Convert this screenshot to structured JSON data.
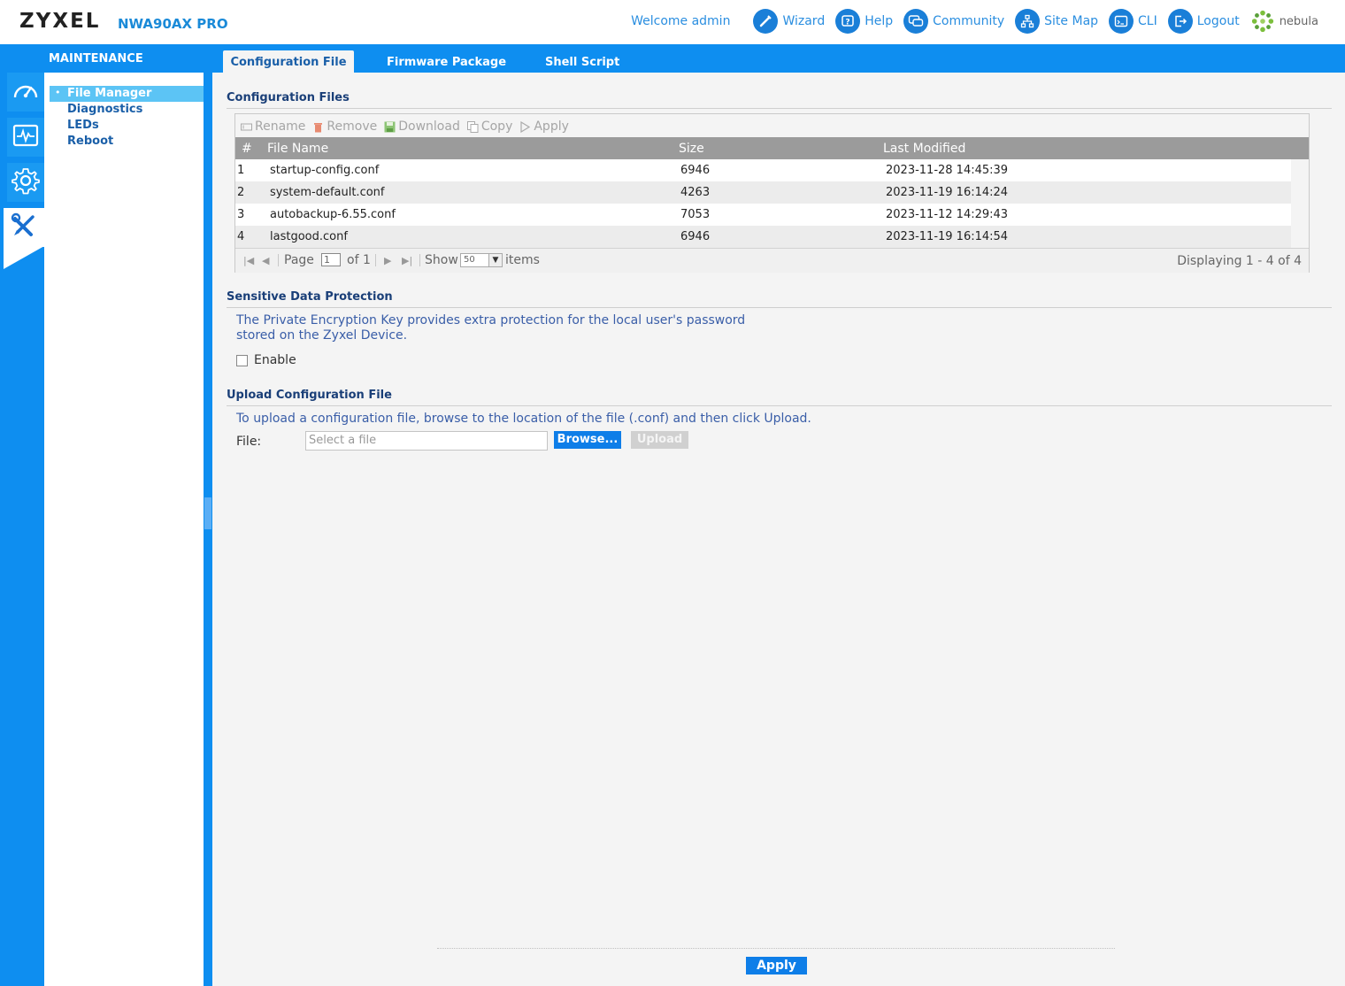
{
  "header": {
    "brand": "ZYXEL",
    "model": "NWA90AX PRO",
    "welcome": "Welcome admin",
    "links": [
      {
        "label": "Wizard",
        "icon": "wand-icon"
      },
      {
        "label": "Help",
        "icon": "help-icon"
      },
      {
        "label": "Community",
        "icon": "community-icon"
      },
      {
        "label": "Site Map",
        "icon": "sitemap-icon"
      },
      {
        "label": "CLI",
        "icon": "cli-icon"
      },
      {
        "label": "Logout",
        "icon": "logout-icon"
      },
      {
        "label": "nebula",
        "icon": "nebula-logo-icon"
      }
    ]
  },
  "sidebar": {
    "title": "MAINTENANCE",
    "rail": [
      "dashboard-icon",
      "monitor-icon",
      "configuration-gear-icon",
      "maintenance-tools-icon"
    ],
    "items": [
      {
        "label": "File Manager",
        "selected": true
      },
      {
        "label": "Diagnostics"
      },
      {
        "label": "LEDs"
      },
      {
        "label": "Reboot"
      }
    ]
  },
  "tabs": [
    {
      "label": "Configuration File",
      "active": true
    },
    {
      "label": "Firmware Package"
    },
    {
      "label": "Shell Script"
    }
  ],
  "config_files": {
    "title": "Configuration Files",
    "toolbar": [
      "Rename",
      "Remove",
      "Download",
      "Copy",
      "Apply"
    ],
    "columns": [
      "#",
      "File Name",
      "Size",
      "Last Modified"
    ],
    "rows": [
      {
        "num": "1",
        "name": "startup-config.conf",
        "size": "6946",
        "modified": "2023-11-28 14:45:39"
      },
      {
        "num": "2",
        "name": "system-default.conf",
        "size": "4263",
        "modified": "2023-11-19 16:14:24"
      },
      {
        "num": "3",
        "name": "autobackup-6.55.conf",
        "size": "7053",
        "modified": "2023-11-12 14:29:43"
      },
      {
        "num": "4",
        "name": "lastgood.conf",
        "size": "6946",
        "modified": "2023-11-19 16:14:54"
      }
    ],
    "pager": {
      "page_label": "Page",
      "page_value": "1",
      "of_label": "of 1",
      "show_label": "Show",
      "show_value": "50",
      "items_label": "items",
      "displaying": "Displaying 1 - 4 of 4"
    }
  },
  "sensitive": {
    "title": "Sensitive Data Protection",
    "desc_line1": "The Private Encryption Key provides extra protection for the local user's password",
    "desc_line2": "stored on the Zyxel Device.",
    "enable_label": "Enable"
  },
  "upload": {
    "title": "Upload Configuration File",
    "desc": "To upload a configuration file, browse to the location of the file (.conf) and then click Upload.",
    "file_label": "File:",
    "placeholder": "Select a file",
    "browse_label": "Browse...",
    "upload_label": "Upload"
  },
  "footer": {
    "apply_label": "Apply"
  },
  "colors": {
    "accent": "#0e8ef0",
    "button": "#0e7ee8",
    "grid_header": "#9b9b9b"
  }
}
